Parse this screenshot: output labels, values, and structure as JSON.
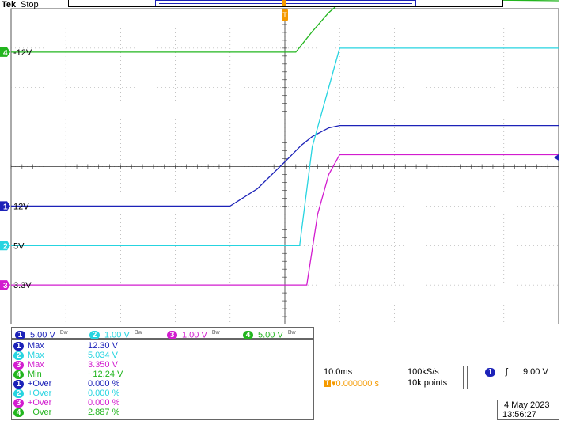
{
  "header": {
    "brand": "Tek",
    "state": "Stop"
  },
  "trigger_marker": "T",
  "colors": {
    "ch1": "#1c22b8",
    "ch2": "#26d4e0",
    "ch3": "#d21ccf",
    "ch4": "#22b51e",
    "trigger": "#f59a00"
  },
  "channels": [
    {
      "num": "1",
      "scale": "5.00 V",
      "marker_label": "12V"
    },
    {
      "num": "2",
      "scale": "1.00 V",
      "marker_label": "5V"
    },
    {
      "num": "3",
      "scale": "1.00 V",
      "marker_label": "3.3V"
    },
    {
      "num": "4",
      "scale": "5.00 V",
      "marker_label": "-12V"
    }
  ],
  "measurements": [
    {
      "ch": "1",
      "name": "Max",
      "value": "12.30 V"
    },
    {
      "ch": "2",
      "name": "Max",
      "value": "5.034 V"
    },
    {
      "ch": "3",
      "name": "Max",
      "value": "3.350 V"
    },
    {
      "ch": "4",
      "name": "Min",
      "value": "−12.24 V"
    },
    {
      "ch": "1",
      "name": "+Over",
      "value": "0.000 %"
    },
    {
      "ch": "2",
      "name": "+Over",
      "value": "0.000 %"
    },
    {
      "ch": "3",
      "name": "+Over",
      "value": "0.000 %"
    },
    {
      "ch": "4",
      "name": "−Over",
      "value": "2.887 %"
    }
  ],
  "timebase": {
    "scale": "10.0ms",
    "position": "▾0.000000 s"
  },
  "acquisition": {
    "rate": "100kS/s",
    "points": "10k points"
  },
  "trigger": {
    "ch": "1",
    "slope": "ʃ",
    "level": "9.00 V"
  },
  "datetime": {
    "date": "4 May 2023",
    "time": "13:56:27"
  },
  "chart_data": {
    "type": "line",
    "x_unit": "ms",
    "x_range": [
      -50,
      50
    ],
    "x_div": 10,
    "series": [
      {
        "name": "12V",
        "channel": "1",
        "volts_per_div": 5,
        "x": [
          -50,
          -25,
          -10,
          -5,
          0,
          3,
          5,
          8,
          10,
          50
        ],
        "y": [
          0,
          0,
          0,
          2.2,
          5.6,
          7.7,
          8.8,
          9.9,
          10.2,
          10.2
        ]
      },
      {
        "name": "5V",
        "channel": "2",
        "volts_per_div": 1,
        "x": [
          -50,
          0,
          2.7,
          5,
          10,
          50
        ],
        "y": [
          0,
          0,
          0,
          2.5,
          5.0,
          5.0
        ]
      },
      {
        "name": "3.3V",
        "channel": "3",
        "volts_per_div": 1,
        "x": [
          -50,
          0,
          4,
          6,
          8,
          10,
          50
        ],
        "y": [
          0,
          0,
          0,
          1.8,
          2.8,
          3.3,
          3.3
        ]
      },
      {
        "name": "-12V",
        "channel": "4",
        "volts_per_div": 5,
        "x": [
          -50,
          0,
          2,
          5,
          8,
          10,
          15,
          25,
          50
        ],
        "y": [
          -12,
          -12,
          -12,
          -9.4,
          -7.0,
          -5.8,
          -5.5,
          -5.3,
          -5.5
        ]
      }
    ]
  }
}
